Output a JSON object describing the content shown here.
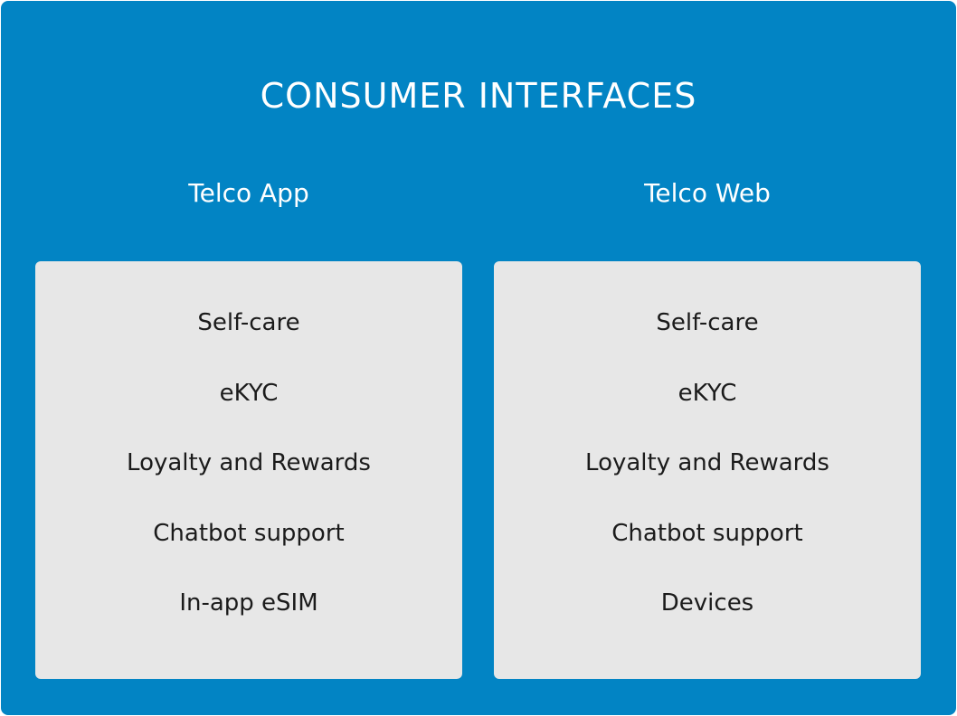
{
  "title": "CONSUMER INTERFACES",
  "columns": [
    {
      "heading": "Telco App",
      "items": [
        "Self-care",
        "eKYC",
        "Loyalty and Rewards",
        "Chatbot support",
        "In-app eSIM"
      ]
    },
    {
      "heading": "Telco Web",
      "items": [
        "Self-care",
        "eKYC",
        "Loyalty and Rewards",
        "Chatbot support",
        "Devices"
      ]
    }
  ],
  "colors": {
    "background": "#0284c4",
    "card": "#e7e7e7",
    "heading_text": "#ffffff",
    "item_text": "#1b1b1b"
  }
}
